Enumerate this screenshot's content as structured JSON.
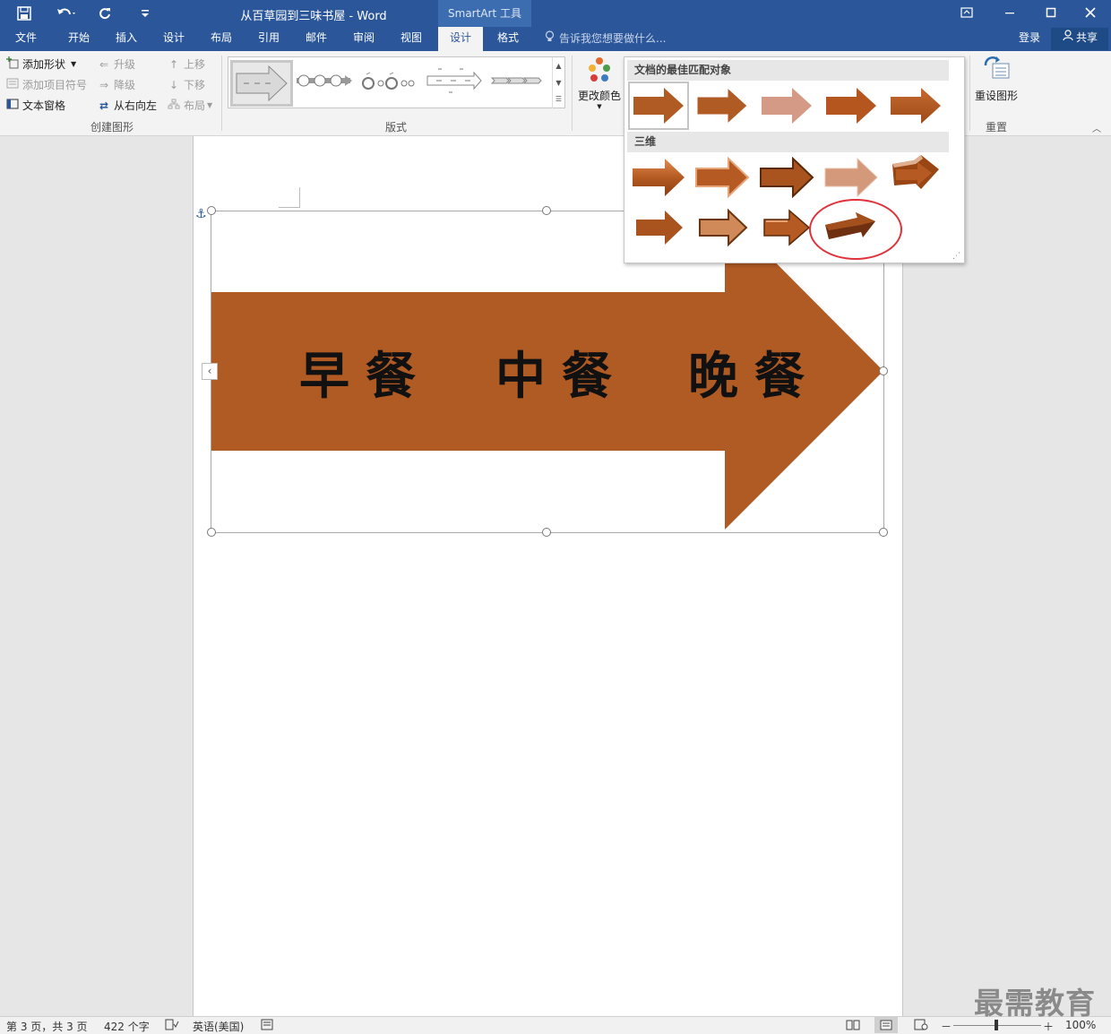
{
  "titlebar": {
    "title": "从百草园到三味书屋 - Word",
    "context_tools": "SmartArt 工具",
    "qat_save_icon": "save-icon",
    "qat_undo_icon": "undo-icon",
    "qat_redo_icon": "redo-icon",
    "qat_customize_icon": "customize-icon"
  },
  "tabs": [
    "文件",
    "开始",
    "插入",
    "设计",
    "布局",
    "引用",
    "邮件",
    "审阅",
    "视图",
    "设计",
    "格式"
  ],
  "active_tab_index": 9,
  "tell_me": "告诉我您想要做什么...",
  "signin": "登录",
  "share": "共享",
  "ribbon": {
    "create_graphic": {
      "add_shape": "添加形状",
      "add_bullet": "添加项目符号",
      "text_pane": "文本窗格",
      "promote": "升级",
      "demote": "降级",
      "right_to_left": "从右向左",
      "move_up": "上移",
      "move_down": "下移",
      "layout": "布局",
      "label": "创建图形"
    },
    "layouts": {
      "label": "版式"
    },
    "change_colors": "更改颜色",
    "reset": {
      "button": "重设图形",
      "label": "重置"
    }
  },
  "style_panel": {
    "best_match_header": "文档的最佳匹配对象",
    "threed_header": "三维"
  },
  "smartart": {
    "items": [
      "早餐",
      "中餐",
      "晚餐"
    ],
    "fill_color": "#b05a24"
  },
  "statusbar": {
    "page": "第 3 页，共 3 页",
    "words": "422 个字",
    "language": "英语(美国)",
    "zoom": "100%"
  },
  "watermark": "最需教育"
}
